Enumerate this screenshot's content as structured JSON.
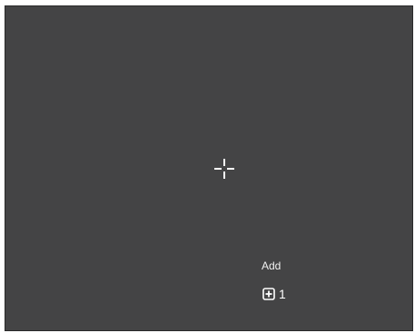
{
  "canvas": {
    "background_color": "#444445"
  },
  "cursor": {
    "icon": "crosshair-icon"
  },
  "add_control": {
    "label": "Add",
    "icon": "plus-square-icon",
    "count": "1"
  }
}
